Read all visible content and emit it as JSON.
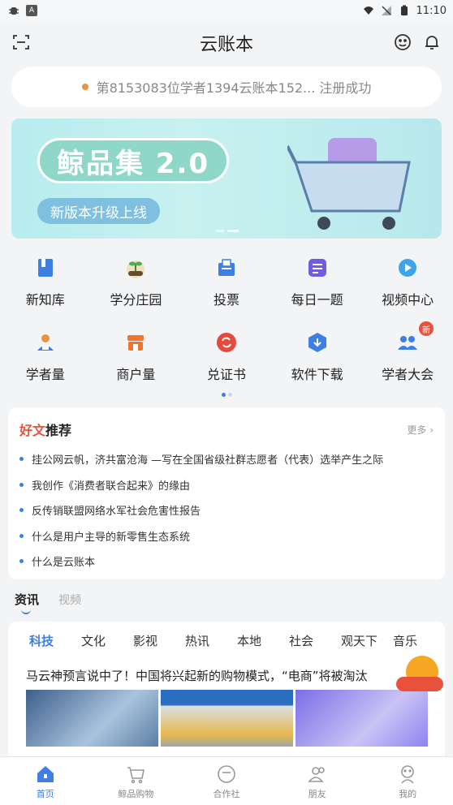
{
  "status_bar": {
    "time": "11:10",
    "app_icon_left": "bug-icon",
    "app_icon_a": "A"
  },
  "header": {
    "title": "云账本"
  },
  "notice": {
    "text": "第8153083位学者1394云账本152...  注册成功"
  },
  "banner": {
    "title": "鲸品集 2.0",
    "subtitle": "新版本升级上线"
  },
  "grid": {
    "row1": [
      {
        "label": "新知库",
        "icon": "book-icon",
        "color": "#3d7fe3"
      },
      {
        "label": "学分庄园",
        "icon": "plant-icon",
        "color": "#6a4a2b"
      },
      {
        "label": "投票",
        "icon": "ballot-icon",
        "color": "#3d7fe3"
      },
      {
        "label": "每日一题",
        "icon": "list-icon",
        "color": "#6f5ce0"
      },
      {
        "label": "视频中心",
        "icon": "video-icon",
        "color": "#3da5e8"
      }
    ],
    "row2": [
      {
        "label": "学者量",
        "icon": "scholar-icon",
        "color": "#e8933d"
      },
      {
        "label": "商户量",
        "icon": "shop-icon",
        "color": "#f0742e"
      },
      {
        "label": "兑证书",
        "icon": "exchange-icon",
        "color": "#e64a3d"
      },
      {
        "label": "软件下载",
        "icon": "download-icon",
        "color": "#3d7fe3"
      },
      {
        "label": "学者大会",
        "icon": "group-icon",
        "color": "#3d7fe3",
        "badge": "新"
      }
    ]
  },
  "articles": {
    "title_highlight": "好文",
    "title_rest": "推荐",
    "more": "更多 ›",
    "items": [
      "挂公网云帆，济共富沧海 —写在全国省级社群志愿者（代表）选举产生之际",
      "我创作《消费者联合起来》的缘由",
      "反传销联盟网络水军社会危害性报告",
      "什么是用户主导的新零售生态系统",
      "什么是云账本"
    ]
  },
  "feed_tabs": [
    "资讯",
    "视频"
  ],
  "categories": [
    "科技",
    "文化",
    "影视",
    "热讯",
    "本地",
    "社会",
    "观天下",
    "音乐"
  ],
  "news": {
    "title": "马云神预言说中了！中国将兴起新的购物模式，“电商”将被淘汰"
  },
  "bottom_nav": [
    {
      "label": "首页",
      "icon": "home-icon"
    },
    {
      "label": "鲸品购物",
      "icon": "cart-icon"
    },
    {
      "label": "合作社",
      "icon": "cooperative-icon"
    },
    {
      "label": "朋友",
      "icon": "friends-icon"
    },
    {
      "label": "我的",
      "icon": "profile-icon"
    }
  ]
}
